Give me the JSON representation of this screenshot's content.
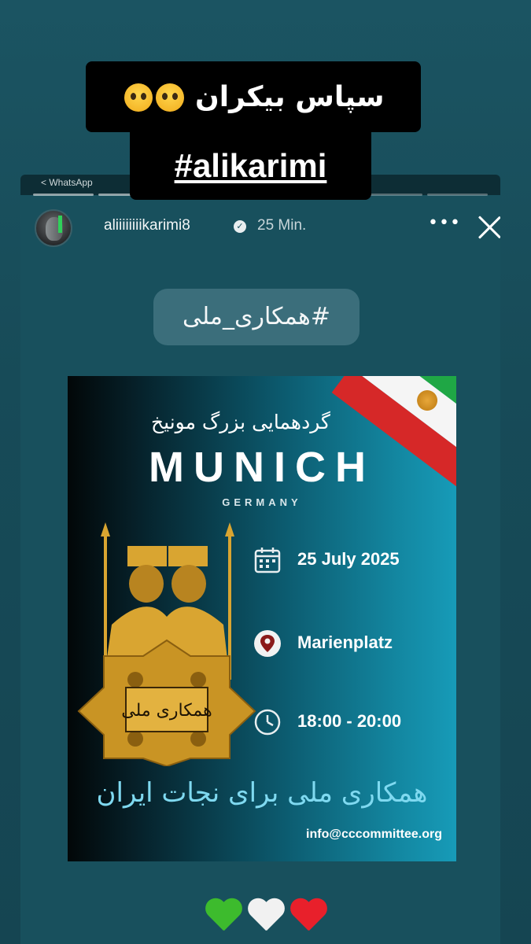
{
  "story_caption": {
    "line1_text": "سپاس بیکران",
    "line1_emoji": [
      "🥹",
      "🥹"
    ],
    "line2_text": "#alikarimi"
  },
  "embedded_story": {
    "top_label": "< WhatsApp",
    "username": "aliiiiiiiikarimi8",
    "verified_icon": "verified-badge-icon",
    "time_ago": "25 Min.",
    "more_icon": "more-options-icon",
    "close_icon": "close-icon",
    "hashtag": "#همکاری_ملی"
  },
  "poster": {
    "title_fa": "گردهمایی بزرگ مونیخ",
    "city": "MUNICH",
    "country": "GERMANY",
    "emblem_text": "همکاری ملی",
    "date_icon": "calendar-icon",
    "date": "25 July 2025",
    "location_icon": "location-pin-icon",
    "location": "Marienplatz",
    "time_icon": "clock-icon",
    "time": "18:00 - 20:00",
    "slogan": "همکاری ملی برای نجات ایران",
    "email": "info@cccommittee.org"
  },
  "reactions": [
    "green-heart",
    "white-heart",
    "red-heart"
  ],
  "colors": {
    "background": "#174a57",
    "slogan_blue": "#7fd9f0",
    "flag_green": "#1fa745",
    "flag_red": "#d62828",
    "gold": "#d9a531"
  }
}
